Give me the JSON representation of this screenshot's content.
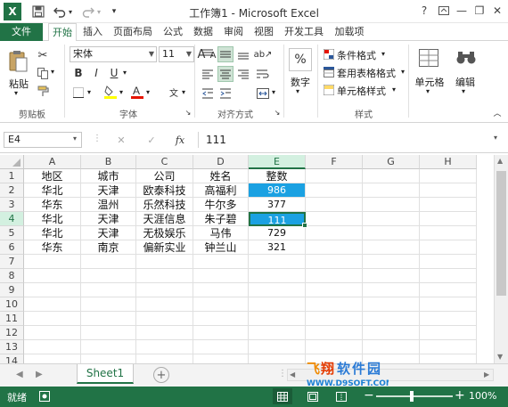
{
  "window": {
    "title": "工作簿1 - Microsoft Excel",
    "help": "?",
    "minimize": "—",
    "restore": "❐",
    "close": "✕"
  },
  "quick_access": {
    "save_icon": "save-icon",
    "undo_icon": "undo-icon",
    "redo_icon": "redo-icon"
  },
  "tabs": {
    "file": "文件",
    "items": [
      "开始",
      "插入",
      "页面布局",
      "公式",
      "数据",
      "审阅",
      "视图",
      "开发工具",
      "加载项"
    ]
  },
  "ribbon": {
    "clipboard": {
      "paste": "粘贴",
      "label": "剪贴板"
    },
    "font": {
      "name": "宋体",
      "size": "11",
      "bold": "B",
      "italic": "I",
      "underline": "U",
      "grow": "A",
      "shrink": "A",
      "label": "字体"
    },
    "alignment": {
      "label": "对齐方式"
    },
    "number": {
      "percent": "%",
      "label": "数字"
    },
    "styles": {
      "conditional": "条件格式",
      "table": "套用表格格式",
      "cell": "单元格样式",
      "label": "样式"
    },
    "cells": {
      "label": "单元格"
    },
    "editing": {
      "label": "编辑"
    }
  },
  "formula_bar": {
    "name_box": "E4",
    "cancel": "✕",
    "enter": "✓",
    "fx": "fx",
    "content": "111"
  },
  "grid": {
    "columns": [
      "A",
      "B",
      "C",
      "D",
      "E",
      "F",
      "G",
      "H"
    ],
    "rows": [
      "1",
      "2",
      "3",
      "4",
      "5",
      "6",
      "7",
      "8",
      "9",
      "10",
      "11",
      "12",
      "13",
      "14"
    ],
    "cells": [
      [
        "地区",
        "城市",
        "公司",
        "姓名",
        "整数"
      ],
      [
        "华北",
        "天津",
        "欧泰科技",
        "高福利",
        "986"
      ],
      [
        "华东",
        "温州",
        "乐然科技",
        "牛尔多",
        "377"
      ],
      [
        "华北",
        "天津",
        "天涯信息",
        "朱子碧",
        "111"
      ],
      [
        "华北",
        "天津",
        "无极娱乐",
        "马伟",
        "729"
      ],
      [
        "华东",
        "南京",
        "偏新实业",
        "钟兰山",
        "321"
      ]
    ],
    "highlight_color": "#1ba1e2",
    "selected_cell": "E4"
  },
  "sheet_tabs": {
    "active": "Sheet1",
    "add": "+"
  },
  "watermark": {
    "logo": "飞翔软件园",
    "url": "WWW.D9SOFT.COM"
  },
  "status_bar": {
    "mode": "就绪",
    "zoom": "100%",
    "zoom_minus": "−",
    "zoom_plus": "+"
  },
  "colors": {
    "excel_green": "#217346"
  }
}
